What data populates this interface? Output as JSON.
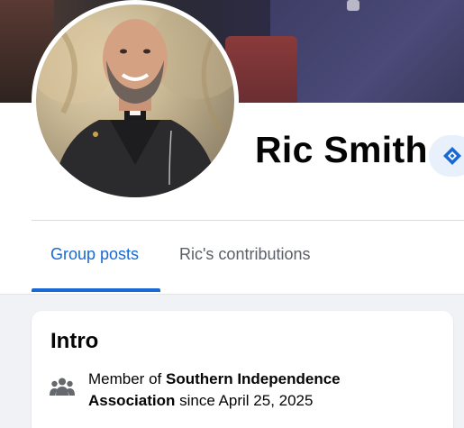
{
  "profile": {
    "name": "Ric Smith",
    "badge_icon": "admin-diamond-badge-icon",
    "avatar_icon": "profile-photo"
  },
  "tabs": [
    {
      "label": "Group posts",
      "active": true
    },
    {
      "label": "Ric's contributions",
      "active": false
    }
  ],
  "intro": {
    "title": "Intro",
    "icon": "group-members-icon",
    "member_prefix": "Member of ",
    "group_name": "Southern Independence Association",
    "since_text": " since April 25, 2025"
  },
  "colors": {
    "accent": "#1868d6",
    "text_primary": "#050505",
    "text_secondary": "#5b5f66",
    "feed_background": "#f0f2f5",
    "badge_background": "#e7f0fb"
  }
}
